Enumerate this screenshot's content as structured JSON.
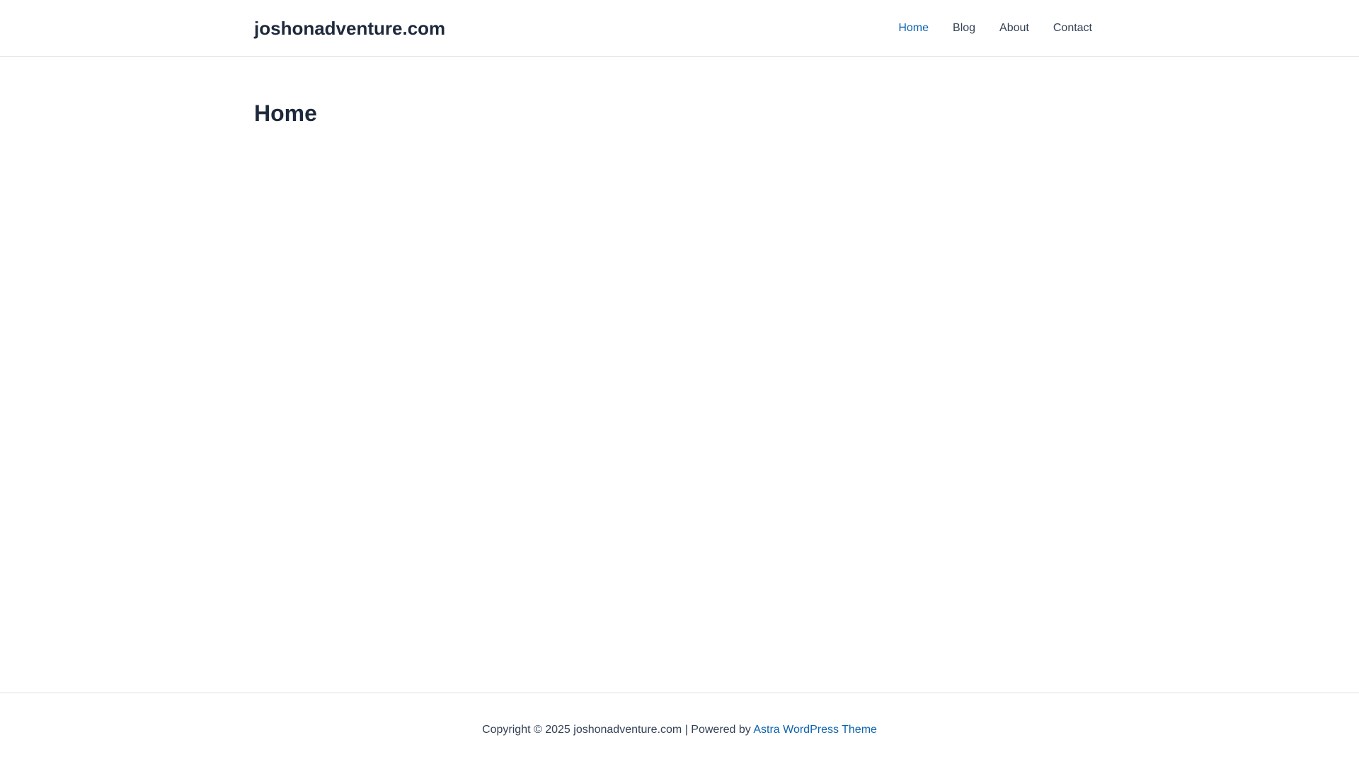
{
  "header": {
    "site_title": "joshonadventure.com",
    "nav": [
      {
        "label": "Home",
        "active": true
      },
      {
        "label": "Blog",
        "active": false
      },
      {
        "label": "About",
        "active": false
      },
      {
        "label": "Contact",
        "active": false
      }
    ]
  },
  "main": {
    "page_title": "Home"
  },
  "footer": {
    "copyright_text": "Copyright © 2025 joshonadventure.com | Powered by ",
    "theme_link": "Astra WordPress Theme"
  },
  "colors": {
    "text": "#1e293b",
    "link_accent": "#0c63b0",
    "border": "#dcdfe3",
    "background": "#ffffff"
  }
}
